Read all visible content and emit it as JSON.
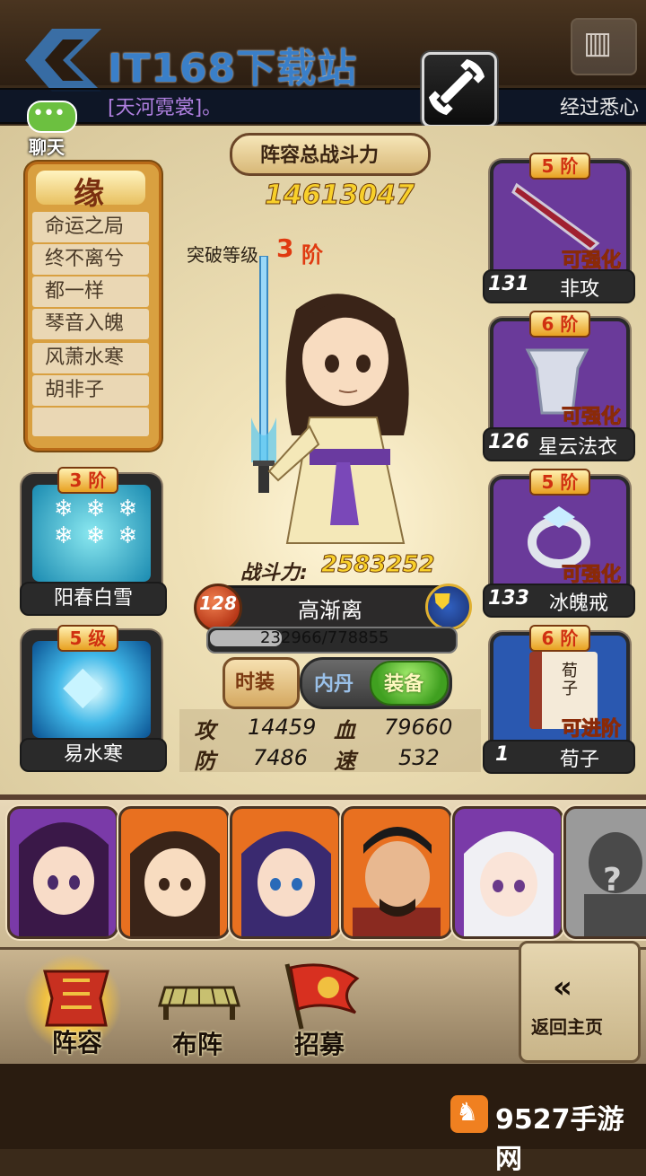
{
  "watermark": {
    "text": "IT168下载站"
  },
  "marquee": {
    "left_text": "[天河霓裳]。",
    "right_text": "经过悉心"
  },
  "chat": {
    "label": "聊天",
    "dots": "•••"
  },
  "fate": {
    "title": "缘",
    "items": [
      "命运之局",
      "终不离兮",
      "都一样",
      "琴音入魄",
      "风萧水寒",
      "胡非子"
    ]
  },
  "team_power": {
    "title": "阵容总战斗力",
    "value": "14613047"
  },
  "breakthrough": {
    "label": "突破等级",
    "value": "3",
    "unit": "阶"
  },
  "hero": {
    "power_label": "战斗力:",
    "power_value": "2583252",
    "level": "128",
    "name": "高渐离",
    "exp_text": "232966/778855",
    "exp_fraction": 0.299
  },
  "tabs": {
    "fashion": "时装",
    "neidan": "内丹",
    "equip": "装备"
  },
  "stats": {
    "atk_label": "攻",
    "atk_value": "14459",
    "hp_label": "血",
    "hp_value": "79660",
    "def_label": "防",
    "def_value": "7486",
    "spd_label": "速",
    "spd_value": "532"
  },
  "left_cards": [
    {
      "rank": "3 阶",
      "name": "阳春白雪"
    },
    {
      "rank": "5 级",
      "name": "易水寒"
    }
  ],
  "right_cards": [
    {
      "rank": "5 阶",
      "level": "131",
      "name": "非攻",
      "tag": "可强化"
    },
    {
      "rank": "6 阶",
      "level": "126",
      "name": "星云法衣",
      "tag": "可强化"
    },
    {
      "rank": "5 阶",
      "level": "133",
      "name": "冰魄戒",
      "tag": "可强化"
    },
    {
      "rank": "6 阶",
      "level": "1",
      "name": "荀子",
      "tag": "可进阶"
    }
  ],
  "book_text": "荀子",
  "locked_slot": "?",
  "nav": {
    "lineup": "阵容",
    "formation": "布阵",
    "recruit": "招募",
    "back": "返回主页",
    "back_icon": "«"
  },
  "footer": {
    "text": "9527手游网"
  },
  "colors": {
    "purple_card": "#6a3a9a",
    "blue_card": "#2a58b0",
    "ice_card": "#2aa0c8",
    "gold": "#f8d02a"
  }
}
